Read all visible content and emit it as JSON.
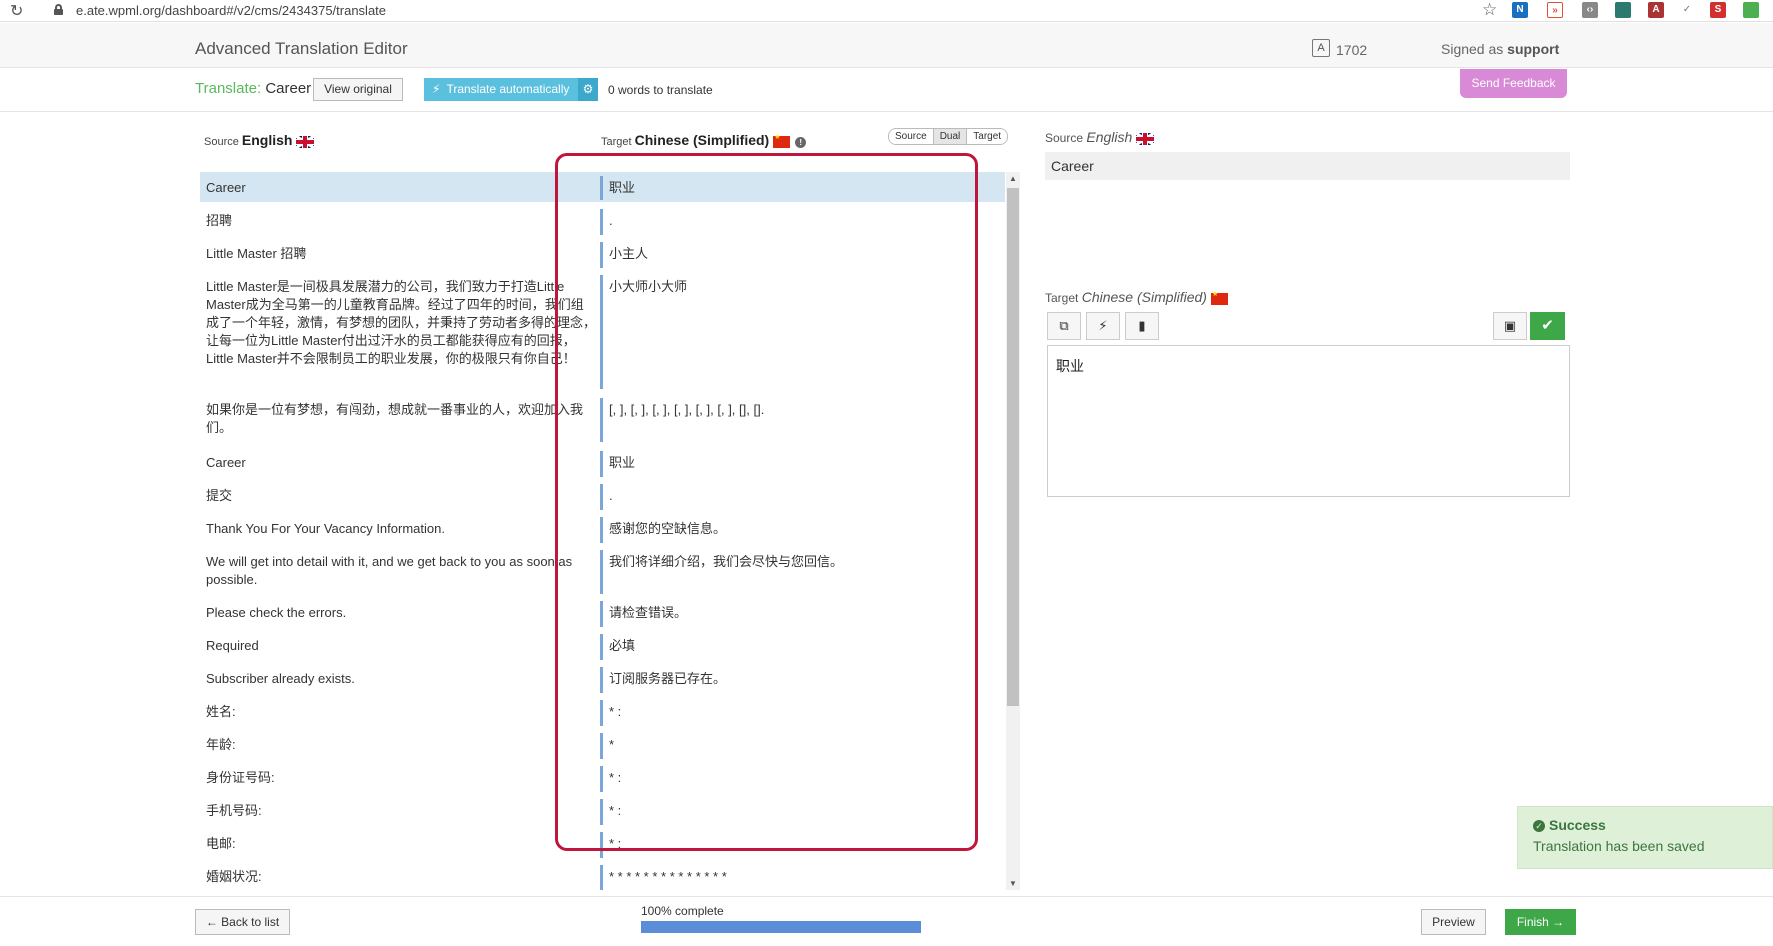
{
  "browser": {
    "url": "e.ate.wpml.org/dashboard#/v2/cms/2434375/translate"
  },
  "header": {
    "title": "Advanced Translation Editor",
    "word_count": "1702",
    "signed_as_prefix": "Signed as",
    "user": "support"
  },
  "toolbar": {
    "translate_prefix": "Translate:",
    "translate_item": "Career",
    "view_original": "View original",
    "translate_automatically": "Translate automatically",
    "words_to_translate": "0 words to translate",
    "send_feedback": "Send Feedback"
  },
  "columns": {
    "source_prefix": "Source",
    "source_lang": "English",
    "target_prefix": "Target",
    "target_lang": "Chinese (Simplified)",
    "toggle": [
      "Source",
      "Dual",
      "Target"
    ]
  },
  "segments": [
    {
      "source": "Career",
      "target": "职业"
    },
    {
      "source": "招聘",
      "target": "."
    },
    {
      "source": "Little Master 招聘",
      "target": "小主人"
    },
    {
      "source": "Little Master是一间极具发展潜力的公司，我们致力于打造Little Master成为全马第一的儿童教育品牌。经过了四年的时间，我们组成了一个年轻，激情，有梦想的团队，并秉持了劳动者多得的理念，  让每一位为Little Master付出过汗水的员工都能获得应有的回报，  Little Master并不会限制员工的职业发展，你的极限只有你自己！",
      "target": "小大师小大师"
    },
    {
      "source": "如果你是一位有梦想，有闯劲，想成就一番事业的人，欢迎加入我们。",
      "target": "[, ], [, ], [, ], [, ], [, ], [, ], [], []."
    },
    {
      "source": "Career",
      "target": "职业"
    },
    {
      "source": "提交",
      "target": "."
    },
    {
      "source": "Thank You For Your Vacancy Information.",
      "target": "感谢您的空缺信息。"
    },
    {
      "source": "We will get into detail with it, and we get back to you as soon as possible.",
      "target": "我们将详细介绍，我们会尽快与您回信。"
    },
    {
      "source": "Please check the errors.",
      "target": "请检查错误。"
    },
    {
      "source": "Required",
      "target": "必填"
    },
    {
      "source": "Subscriber already exists.",
      "target": "订阅服务器已存在。"
    },
    {
      "source": "姓名:",
      "target": "* :"
    },
    {
      "source": "年龄:",
      "target": "*"
    },
    {
      "source": "身份证号码:",
      "target": "*  :"
    },
    {
      "source": "手机号码:",
      "target": "*  :"
    },
    {
      "source": "电邮:",
      "target": "* :"
    },
    {
      "source": "婚姻状况:",
      "target": "* * * * * * * * * * * * * *"
    }
  ],
  "right_panel": {
    "source_prefix": "Source",
    "source_lang": "English",
    "source_text": "Career",
    "target_prefix": "Target",
    "target_lang": "Chinese (Simplified)",
    "target_text": "职业"
  },
  "toast": {
    "title": "Success",
    "message": "Translation has been saved"
  },
  "footer": {
    "back": "← Back to list",
    "progress_label": "100% complete",
    "progress": 1.0,
    "preview": "Preview",
    "finish": "Finish →"
  },
  "colors": {
    "accent_green": "#3ea748",
    "highlight_red": "#c0163b",
    "feedback_pink": "#d98ad6",
    "auto_blue": "#5bc0de"
  }
}
